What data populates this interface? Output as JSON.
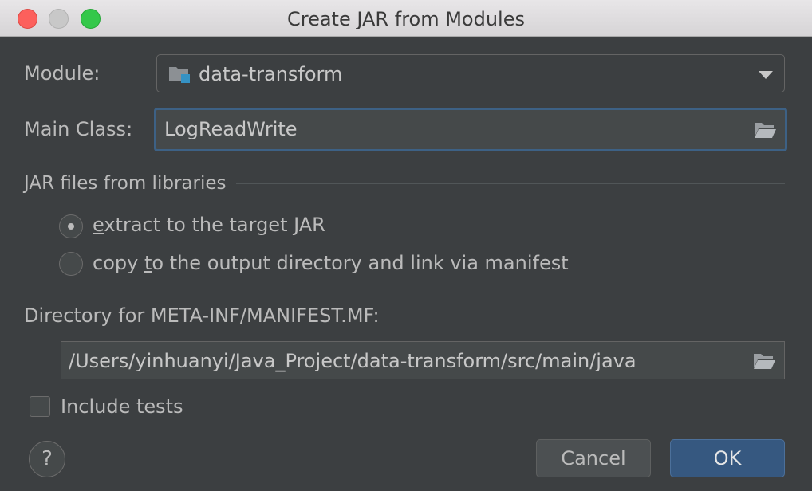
{
  "window": {
    "title": "Create JAR from Modules"
  },
  "module": {
    "label": "Module:",
    "value": "data-transform"
  },
  "main_class": {
    "label": "Main Class:",
    "value": "LogReadWrite"
  },
  "libraries": {
    "section_title": "JAR files from libraries",
    "option_extract": {
      "mnemonic": "e",
      "rest": "xtract to the target JAR",
      "selected": true
    },
    "option_copy": {
      "before": "copy ",
      "mnemonic": "t",
      "after": "o the output directory and link via manifest",
      "selected": false
    }
  },
  "manifest": {
    "label": "Directory for META-INF/MANIFEST.MF:",
    "value": "/Users/yinhuanyi/Java_Project/data-transform/src/main/java"
  },
  "include_tests": {
    "label": "Include tests",
    "checked": false
  },
  "buttons": {
    "help": "?",
    "cancel": "Cancel",
    "ok": "OK"
  },
  "icons": {
    "module": "module-folder-icon",
    "browse": "folder-open-icon"
  },
  "colors": {
    "background": "#3c3f41",
    "accent": "#365880",
    "focus": "#3d6185"
  }
}
